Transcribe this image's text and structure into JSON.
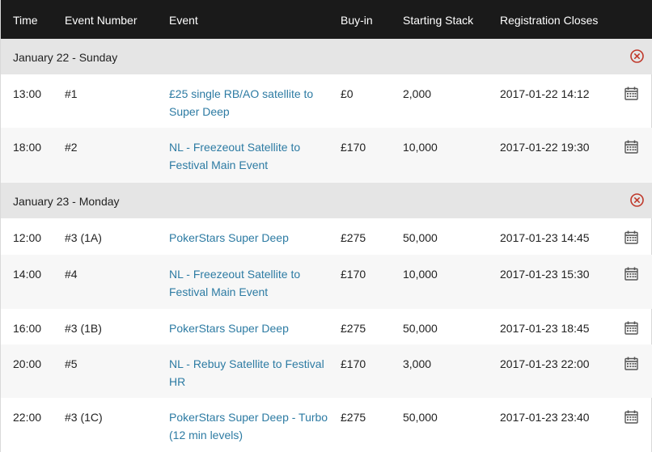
{
  "columns": {
    "time": "Time",
    "event_number": "Event Number",
    "event": "Event",
    "buyin": "Buy-in",
    "stack": "Starting Stack",
    "reg": "Registration Closes"
  },
  "groups": [
    {
      "label": "January 22 - Sunday",
      "rows": [
        {
          "time": "13:00",
          "num": "#1",
          "event": "£25 single RB/AO satellite to Super Deep",
          "buyin": "£0",
          "stack": "2,000",
          "reg": "2017-01-22 14:12"
        },
        {
          "time": "18:00",
          "num": "#2",
          "event": "NL - Freezeout Satellite to Festival Main Event",
          "buyin": "£170",
          "stack": "10,000",
          "reg": "2017-01-22 19:30"
        }
      ]
    },
    {
      "label": "January 23 - Monday",
      "rows": [
        {
          "time": "12:00",
          "num": "#3 (1A)",
          "event": "PokerStars Super Deep",
          "buyin": "£275",
          "stack": "50,000",
          "reg": "2017-01-23 14:45"
        },
        {
          "time": "14:00",
          "num": "#4",
          "event": "NL - Freezeout Satellite to Festival Main Event",
          "buyin": "£170",
          "stack": "10,000",
          "reg": "2017-01-23 15:30"
        },
        {
          "time": "16:00",
          "num": "#3 (1B)",
          "event": "PokerStars Super Deep",
          "buyin": "£275",
          "stack": "50,000",
          "reg": "2017-01-23 18:45"
        },
        {
          "time": "20:00",
          "num": "#5",
          "event": "NL - Rebuy Satellite to Festival HR",
          "buyin": "£170",
          "stack": "3,000",
          "reg": "2017-01-23 22:00"
        },
        {
          "time": "22:00",
          "num": "#3 (1C)",
          "event": "PokerStars Super Deep - Turbo (12 min levels)",
          "buyin": "£275",
          "stack": "50,000",
          "reg": "2017-01-23 23:40"
        }
      ]
    }
  ],
  "icons": {
    "close": "close-circle-icon",
    "calendar": "calendar-icon"
  },
  "colors": {
    "header_bg": "#1a1a1a",
    "group_bg": "#e5e5e5",
    "alt_row_bg": "#f7f7f7",
    "link": "#2d7ba3",
    "close_icon": "#c0392b",
    "calendar_icon": "#555555"
  }
}
